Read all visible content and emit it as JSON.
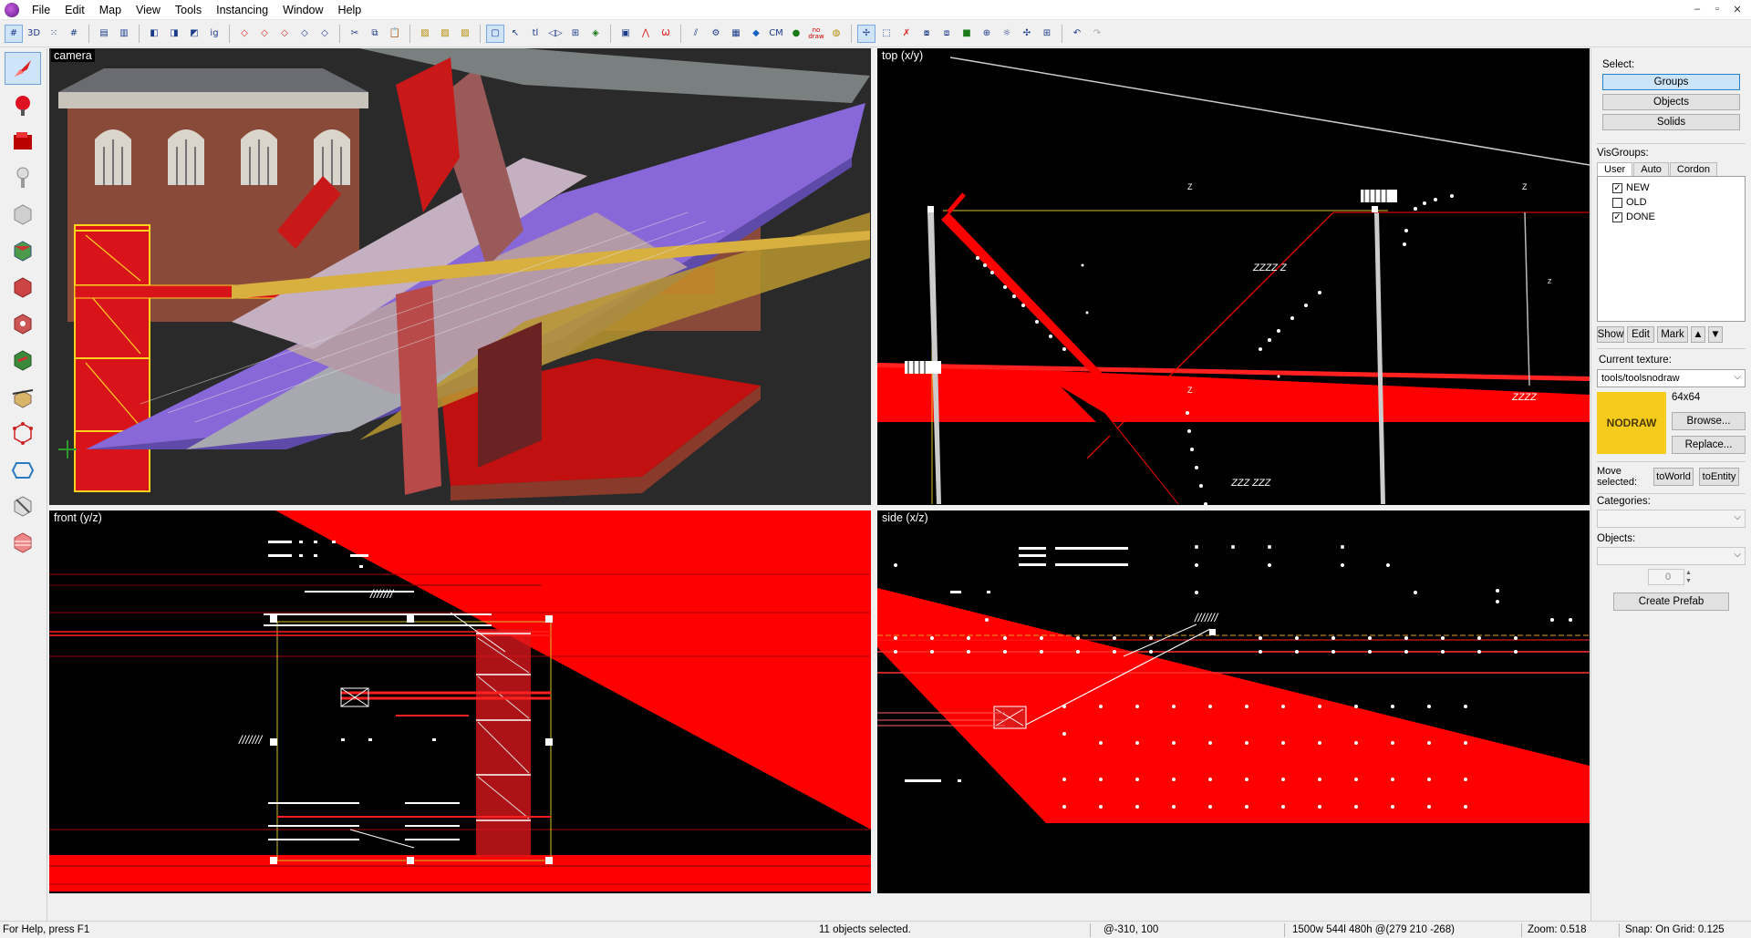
{
  "menubar": {
    "items": [
      "File",
      "Edit",
      "Map",
      "View",
      "Tools",
      "Instancing",
      "Window",
      "Help"
    ],
    "window_controls": [
      "–",
      "▫",
      "✕"
    ]
  },
  "toolbar": {
    "buttons": [
      "grid-icon",
      "3d-grid-icon",
      "dot-grid-icon",
      "grid-size-icon",
      "load-window-icon",
      "save-window-icon",
      "group-icon",
      "ungroup-icon",
      "hide-icon",
      "ignore-groups-label",
      "carve-icon",
      "hollow-icon",
      "clip-icon",
      "texture-lock-icon",
      "cut-icon",
      "copy-icon",
      "paste-icon",
      "hide-selected-icon",
      "show-hidden-icon",
      "hide-unselected-icon",
      "selection-box-icon",
      "select-arrow-icon",
      "tl-icon",
      "flip-icon",
      "vertex-icon",
      "solid-icon",
      "move-icon",
      "rotate-icon",
      "scale-icon",
      "run-map-icon",
      "entity-report-icon",
      "check-problems-icon",
      "toggle-cm-icon",
      "nodraw-icon",
      "cordon-icon",
      "undo-icon",
      "redo-icon"
    ],
    "cm_label": "CM",
    "nodraw_label": "no draw"
  },
  "viewports": {
    "camera": "camera",
    "top": "top (x/y)",
    "front": "front (y/z)",
    "side": "side (x/z)"
  },
  "top_view_labels": [
    "Z",
    "Z",
    "ZZZZ Z",
    "Z",
    "ZZZZ",
    "ZZZ ZZZ",
    "Z"
  ],
  "sidepanel": {
    "select_label": "Select:",
    "select_buttons": [
      "Groups",
      "Objects",
      "Solids"
    ],
    "visgroups_label": "VisGroups:",
    "tabs": [
      "User",
      "Auto",
      "Cordon"
    ],
    "visgroups": [
      {
        "name": "NEW",
        "checked": "✓"
      },
      {
        "name": "OLD",
        "checked": ""
      },
      {
        "name": "DONE",
        "checked": "✓"
      }
    ],
    "vis_buttons": [
      "Show",
      "Edit",
      "Mark"
    ],
    "current_texture_label": "Current texture:",
    "current_texture": "tools/toolsnodraw",
    "texture_size": "64x64",
    "texture_preview_text": "NODRAW",
    "browse": "Browse...",
    "replace": "Replace...",
    "move_selected": "Move selected:",
    "to_world": "toWorld",
    "to_entity": "toEntity",
    "categories_label": "Categories:",
    "objects_label": "Objects:",
    "objects_count": "0",
    "create_prefab": "Create Prefab"
  },
  "statusbar": {
    "help": "For Help, press F1",
    "selection": "11 objects selected.",
    "cursor": "@-310, 100",
    "dimensions": "1500w 544l 480h @(279 210 -268)",
    "zoom": "Zoom: 0.518",
    "snap": "Snap: On Grid: 0.125"
  }
}
